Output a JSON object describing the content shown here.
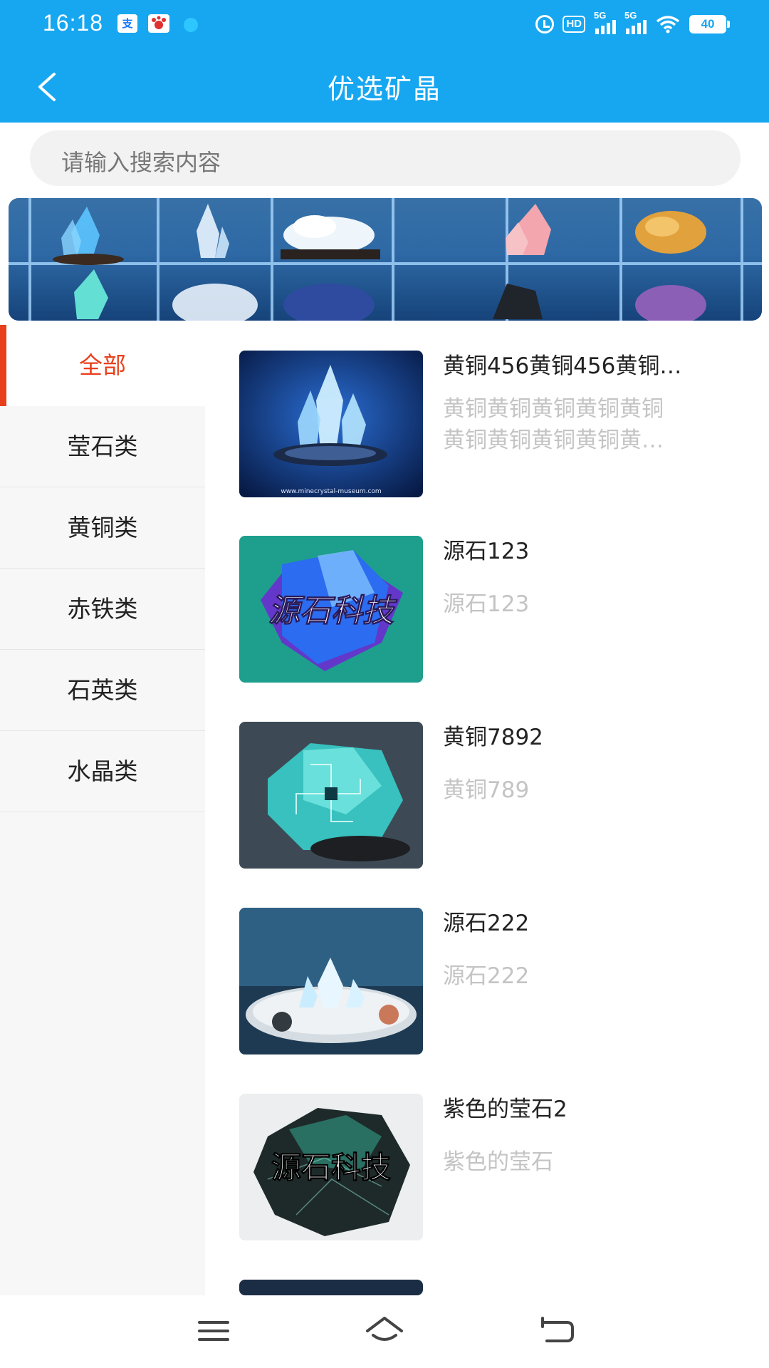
{
  "status_bar": {
    "time": "16:18",
    "alipay_glyph": "支",
    "hd_label": "HD",
    "signal_label": "5G",
    "battery": "40",
    "icons": [
      "alipay-icon",
      "baidu-icon",
      "bubble-icon",
      "alarm-icon",
      "hd-icon",
      "signal-icon",
      "wifi-icon",
      "battery-icon"
    ]
  },
  "header": {
    "title": "优选矿晶",
    "back_icon": "chevron-left-icon"
  },
  "search": {
    "placeholder": "请输入搜索内容"
  },
  "sidebar": {
    "categories": [
      {
        "label": "全部",
        "active": true
      },
      {
        "label": "莹石类",
        "active": false
      },
      {
        "label": "黄铜类",
        "active": false
      },
      {
        "label": "赤铁类",
        "active": false
      },
      {
        "label": "石英类",
        "active": false
      },
      {
        "label": "水晶类",
        "active": false
      }
    ]
  },
  "products": [
    {
      "name": "黄铜456黄铜456黄铜…",
      "desc_line1": "黄铜黄铜黄铜黄铜黄铜",
      "desc_line2": "黄铜黄铜黄铜黄铜黄…",
      "image_caption": "www.minecrystal-museum.com"
    },
    {
      "name": "源石123",
      "desc": "源石123",
      "image_text": "源石科技"
    },
    {
      "name": "黄铜7892",
      "desc": "黄铜789"
    },
    {
      "name": "源石222",
      "desc": "源石222"
    },
    {
      "name": "紫色的莹石2",
      "desc": "紫色的莹石",
      "image_text": "源石科技"
    }
  ],
  "nav_bar": {
    "icons": [
      "menu-icon",
      "home-icon",
      "back-icon"
    ]
  },
  "colors": {
    "header_bg": "#17a7f0",
    "accent": "#e8401c",
    "sidebar_bg": "#f7f7f7",
    "desc_text": "#c4c4c4"
  }
}
